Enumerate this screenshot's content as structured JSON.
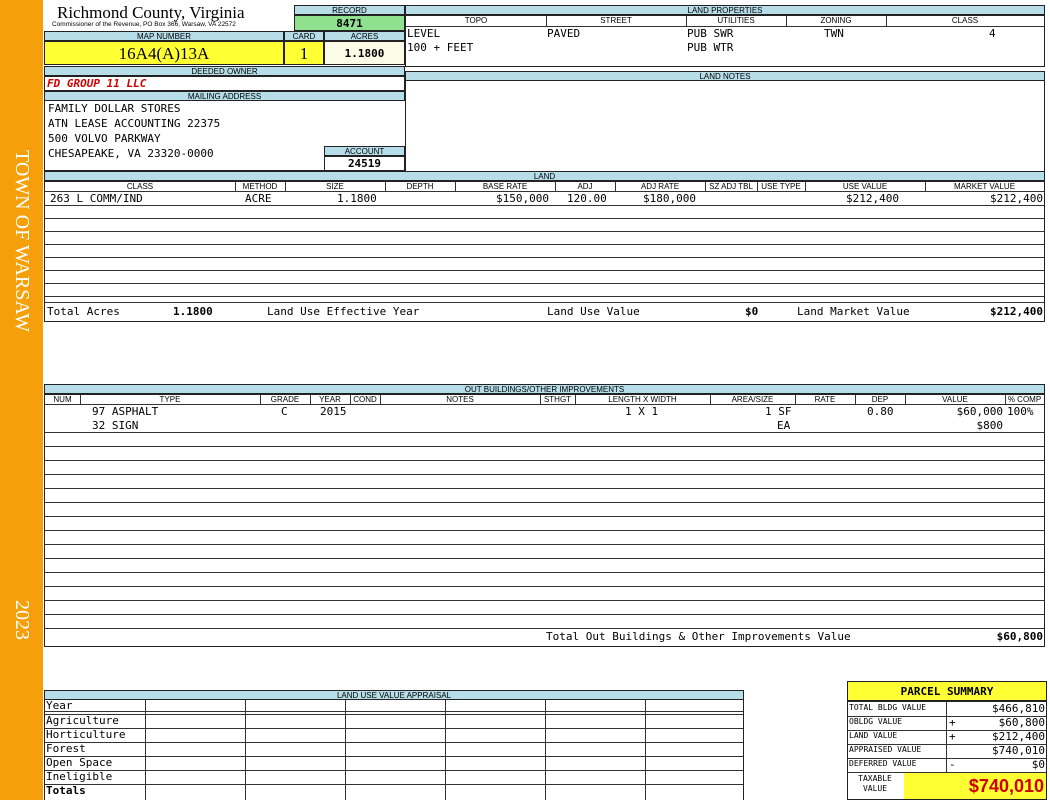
{
  "sidebar": {
    "town": "TOWN OF WARSAW",
    "year": "2023"
  },
  "header": {
    "county": "Richmond County, Virginia",
    "subtitle": "Commissioner of the Revenue, PO Box 366, Warsaw, VA 22572",
    "record_label": "RECORD",
    "record": "8471",
    "map_number_label": "MAP NUMBER",
    "map_number": "16A4(A)13A",
    "card_label": "CARD",
    "card": "1",
    "acres_label": "ACRES",
    "acres": "1.1800"
  },
  "land_properties": {
    "title": "LAND PROPERTIES",
    "headers": [
      "TOPO",
      "STREET",
      "UTILITIES",
      "ZONING",
      "CLASS"
    ],
    "topo": [
      "LEVEL",
      "100 + FEET"
    ],
    "street": "PAVED",
    "utilities": [
      "PUB SWR",
      "PUB WTR"
    ],
    "zoning": "TWN",
    "class": "4"
  },
  "owner": {
    "deeded_label": "DEEDED OWNER",
    "name": "FD GROUP 11 LLC",
    "mailing_label": "MAILING ADDRESS",
    "address": [
      "FAMILY DOLLAR STORES",
      "ATN LEASE ACCOUNTING 22375",
      "500 VOLVO PARKWAY",
      "CHESAPEAKE, VA 23320-0000"
    ],
    "account_label": "ACCOUNT",
    "account": "24519"
  },
  "land_notes": {
    "title": "LAND NOTES"
  },
  "land": {
    "title": "LAND",
    "headers": [
      "CLASS",
      "METHOD",
      "SIZE",
      "DEPTH",
      "BASE RATE",
      "ADJ",
      "ADJ RATE",
      "SZ ADJ TBL",
      "USE TYPE",
      "USE VALUE",
      "MARKET VALUE"
    ],
    "rows": [
      {
        "class": "263 L COMM/IND",
        "method": "ACRE",
        "size": "1.1800",
        "depth": "",
        "base_rate": "$150,000",
        "adj": "120.00",
        "adj_rate": "$180,000",
        "sz_adj": "",
        "use_type": "",
        "use_value": "$212,400",
        "market_value": "$212,400"
      }
    ],
    "total_acres_label": "Total Acres",
    "total_acres": "1.1800",
    "effective_year_label": "Land Use Effective Year",
    "use_value_label": "Land Use Value",
    "use_value": "$0",
    "market_value_label": "Land Market Value",
    "market_value": "$212,400"
  },
  "outbuildings": {
    "title": "OUT BUILDINGS/OTHER IMPROVEMENTS",
    "headers": [
      "NUM",
      "TYPE",
      "GRADE",
      "YEAR",
      "COND",
      "NOTES",
      "STHGT",
      "LENGTH X WIDTH",
      "AREA/SIZE",
      "RATE",
      "DEP",
      "VALUE",
      "% COMP"
    ],
    "rows": [
      {
        "type": "97 ASPHALT",
        "grade": "C",
        "year": "2015",
        "length_width": "1 X 1",
        "area": "1 SF",
        "dep": "0.80",
        "value": "$60,000",
        "comp": "100%"
      },
      {
        "type": "32 SIGN",
        "grade": "",
        "year": "",
        "length_width": "",
        "area": "EA",
        "dep": "",
        "value": "$800",
        "comp": ""
      }
    ],
    "total_label": "Total Out Buildings & Other Improvements Value",
    "total": "$60,800"
  },
  "land_use_appraisal": {
    "title": "LAND USE VALUE APPRAISAL",
    "rows": [
      "Year",
      "Agriculture",
      "Horticulture",
      "Forest",
      "Open Space",
      "Ineligible",
      "Totals"
    ]
  },
  "summary": {
    "title": "PARCEL SUMMARY",
    "rows": [
      {
        "label": "TOTAL BLDG VALUE",
        "sign": "",
        "value": "$466,810"
      },
      {
        "label": "OBLDG VALUE",
        "sign": "+",
        "value": "$60,800"
      },
      {
        "label": "LAND VALUE",
        "sign": "+",
        "value": "$212,400"
      },
      {
        "label": "APPRAISED VALUE",
        "sign": "",
        "value": "$740,010"
      },
      {
        "label": "DEFERRED VALUE",
        "sign": "-",
        "value": "$0"
      }
    ],
    "taxable_label_1": "TAXABLE",
    "taxable_label_2": "VALUE",
    "taxable": "$740,010"
  }
}
